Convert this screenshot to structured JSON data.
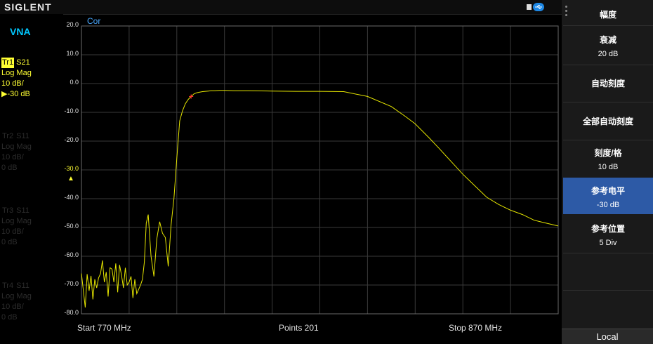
{
  "header": {
    "brand": "SIGLENT",
    "usb_icon": "usb-icon"
  },
  "mode": "VNA",
  "traces": [
    {
      "id": "Tr1",
      "param": "S21",
      "format": "Log Mag",
      "scale": "10 dB/",
      "ref": "▶-30 dB",
      "active": true
    },
    {
      "id": "Tr2",
      "param": "S11",
      "format": "Log Mag",
      "scale": "10 dB/",
      "ref": "0 dB",
      "active": false
    },
    {
      "id": "Tr3",
      "param": "S11",
      "format": "Log Mag",
      "scale": "10 dB/",
      "ref": "0 dB",
      "active": false
    },
    {
      "id": "Tr4",
      "param": "S11",
      "format": "Log Mag",
      "scale": "10 dB/",
      "ref": "0 dB",
      "active": false
    }
  ],
  "graph": {
    "cor_label": "Cor",
    "y_ticks": [
      "20.0",
      "10.0",
      "0.0",
      "-10.0",
      "-20.0",
      "-30.0",
      "-40.0",
      "-50.0",
      "-60.0",
      "-70.0",
      "-80.0"
    ],
    "start": "Start  770 MHz",
    "points": "Points  201",
    "stop": "Stop  870 MHz"
  },
  "softkeys": [
    {
      "title": "幅度",
      "value": ""
    },
    {
      "title": "衰减",
      "value": "20 dB"
    },
    {
      "title": "自动刻度",
      "value": ""
    },
    {
      "title": "全部自动刻度",
      "value": ""
    },
    {
      "title": "刻度/格",
      "value": "10 dB"
    },
    {
      "title": "参考电平",
      "value": "-30 dB",
      "selected": true
    },
    {
      "title": "参考位置",
      "value": "5 Div"
    }
  ],
  "local_label": "Local",
  "colors": {
    "trace": "#e6e600",
    "grid": "#3a3a3a",
    "selected": "#2d5aa6",
    "marker": "#ff3030"
  },
  "chart_data": {
    "type": "line",
    "title": "",
    "xlabel": "",
    "ylabel": "",
    "xlim": [
      770,
      870
    ],
    "ylim": [
      -80,
      20
    ],
    "x_unit": "MHz",
    "y_unit": "dB",
    "grid": true,
    "series": [
      {
        "x": [
          770.0,
          770.8,
          771.2,
          771.6,
          772.0,
          772.4,
          772.8,
          773.2,
          773.6,
          774.0,
          774.4,
          774.8,
          775.2,
          775.6,
          776.0,
          776.4,
          776.8,
          777.2,
          777.6,
          778.0,
          778.4,
          778.8,
          779.2,
          779.6,
          780.0,
          780.4,
          780.8,
          781.2,
          781.6,
          782.0,
          782.4,
          782.8,
          783.2,
          783.6,
          784.0,
          784.6,
          785.2,
          785.8,
          786.4,
          787.0,
          787.6,
          788.2,
          788.8,
          789.4,
          790.0,
          790.6,
          791.2,
          791.8,
          792.4,
          793.0,
          793.6,
          794.2,
          794.8,
          795.4,
          796.0,
          796.6,
          797.2,
          798.0,
          799.0,
          800.0,
          802.0,
          805.0,
          810.0,
          815.0,
          820.0,
          825.0,
          830.0,
          835.0,
          838.0,
          840.0,
          841.5,
          843.0,
          845.0,
          847.5,
          850.0,
          852.5,
          855.0,
          857.5,
          860.0,
          862.5,
          865.0,
          867.5,
          870.0
        ],
        "y": [
          -66.0,
          -77.8,
          -66.2,
          -72.0,
          -66.8,
          -75.0,
          -68.0,
          -71.0,
          -67.5,
          -66.0,
          -61.5,
          -69.0,
          -65.5,
          -74.0,
          -64.0,
          -64.5,
          -69.0,
          -62.5,
          -72.5,
          -63.0,
          -66.5,
          -71.0,
          -64.0,
          -70.0,
          -69.0,
          -67.0,
          -74.5,
          -68.0,
          -73.0,
          -71.5,
          -70.0,
          -68.0,
          -62.0,
          -48.5,
          -45.5,
          -60.0,
          -67.0,
          -54.0,
          -48.0,
          -52.0,
          -53.5,
          -63.5,
          -49.0,
          -40.0,
          -26.0,
          -13.0,
          -9.5,
          -7.0,
          -5.5,
          -4.5,
          -3.6,
          -3.2,
          -3.0,
          -2.8,
          -2.7,
          -2.6,
          -2.5,
          -2.5,
          -2.4,
          -2.4,
          -2.5,
          -2.5,
          -2.6,
          -2.7,
          -2.7,
          -2.8,
          -4.5,
          -8.0,
          -11.5,
          -14.0,
          -16.5,
          -19.0,
          -22.5,
          -27.0,
          -31.5,
          -35.5,
          -39.5,
          -42.0,
          -44.0,
          -45.5,
          -47.5,
          -48.5,
          -49.5
        ]
      }
    ],
    "marker": {
      "x": 793.0,
      "y": -4.5
    }
  }
}
